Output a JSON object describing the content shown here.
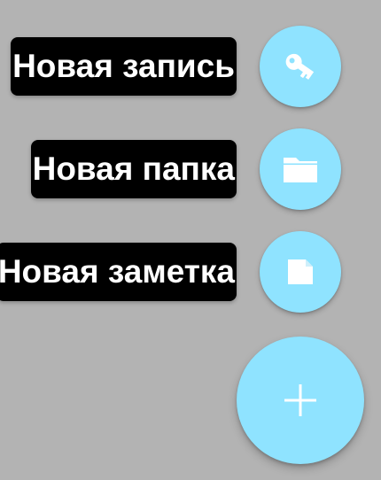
{
  "fab_menu": {
    "actions": [
      {
        "label": "Новая запись",
        "icon": "key-icon"
      },
      {
        "label": "Новая папка",
        "icon": "folder-icon"
      },
      {
        "label": "Новая заметка",
        "icon": "note-icon"
      }
    ],
    "main_button": {
      "icon": "plus-icon"
    }
  },
  "colors": {
    "background": "#b3b3b3",
    "fab": "#8fe3ff",
    "label_background": "#000000",
    "label_text": "#ffffff",
    "icon": "#ffffff"
  }
}
